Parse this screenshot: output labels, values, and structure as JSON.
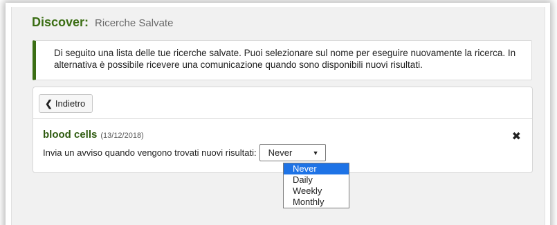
{
  "title": {
    "main": "Discover:",
    "sub": "Ricerche Salvate"
  },
  "info_text": "Di seguito una lista delle tue ricerche salvate. Puoi selezionare sul nome per eseguire nuovamente la ricerca. In alternativa è possibile ricevere una comunicazione quando sono disponibili nuovi risultati.",
  "back_button": {
    "label": "Indietro",
    "icon": "chevron-left-icon"
  },
  "saved_search": {
    "name": "blood cells",
    "date": "(13/12/2018)",
    "delete_icon": "close-icon",
    "alert_label": "Invia un avviso quando vengono trovati nuovi risultati:",
    "frequency_selected": "Never",
    "frequency_options": [
      "Never",
      "Daily",
      "Weekly",
      "Monthly"
    ]
  },
  "colors": {
    "brand_green": "#3b6e14",
    "selection_blue": "#1e73e6"
  }
}
